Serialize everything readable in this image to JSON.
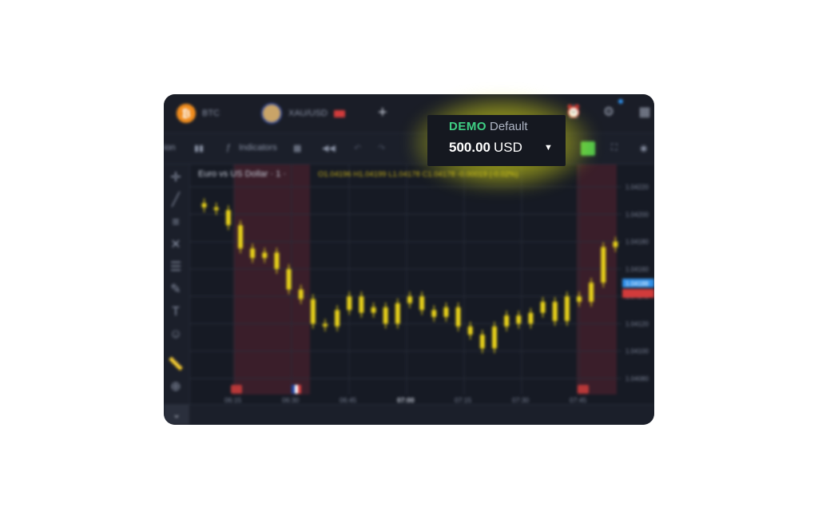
{
  "tabs": [
    {
      "label": "BTC",
      "icon": "btc-coin-icon"
    },
    {
      "label": "XAU/USD",
      "icon": "xau-coin-icon"
    }
  ],
  "toolbar": {
    "left_fragment": "ion",
    "indicators_label": "Indicators"
  },
  "chart": {
    "title": "Euro vs US Dollar · 1 ·",
    "ohlc": "O1.04196  H1.04199  L1.04178  C1.04178  -0.00019 (-0.02%)",
    "price_labels": [
      "1.04220",
      "1.04200",
      "1.04180",
      "1.04160",
      "1.04140",
      "1.04120",
      "1.04100",
      "1.04080"
    ],
    "time_labels": [
      "06:15",
      "06:30",
      "06:45",
      "07:00",
      "07:15",
      "07:30",
      "07:45"
    ],
    "bid_label": "1.04188",
    "ask_label": "1.04177",
    "colors": {
      "candles": "#e9d21a",
      "bid": "#2f8fe8",
      "ask": "#e74c4c",
      "shade": "#5a2230"
    }
  },
  "chart_data": {
    "type": "line",
    "title": "Euro vs US Dollar · 1 ·",
    "xlabel": "",
    "ylabel": "",
    "x": [
      "06:04",
      "06:07",
      "06:10",
      "06:12",
      "06:15",
      "06:18",
      "06:21",
      "06:24",
      "06:27",
      "06:30",
      "06:33",
      "06:36",
      "06:39",
      "06:42",
      "06:45",
      "06:48",
      "06:51",
      "06:54",
      "06:57",
      "07:00",
      "07:03",
      "07:06",
      "07:09",
      "07:12",
      "07:15",
      "07:18",
      "07:21",
      "07:24",
      "07:27",
      "07:30",
      "07:33",
      "07:36",
      "07:39",
      "07:42",
      "07:45"
    ],
    "series": [
      {
        "values": [
          1.04205,
          1.04203,
          1.04192,
          1.04175,
          1.04168,
          1.04172,
          1.0416,
          1.04145,
          1.04138,
          1.0412,
          1.04118,
          1.0413,
          1.0414,
          1.04128,
          1.04132,
          1.0412,
          1.04135,
          1.0414,
          1.0413,
          1.04125,
          1.04132,
          1.04118,
          1.04112,
          1.04102,
          1.04118,
          1.04126,
          1.0412,
          1.04128,
          1.04136,
          1.04122,
          1.0414,
          1.04136,
          1.0415,
          1.04176,
          1.0418
        ]
      }
    ],
    "ylim": [
      1.0408,
      1.0422
    ]
  },
  "account": {
    "mode": "DEMO",
    "name": "Default",
    "balance": "500.00",
    "currency": "USD"
  }
}
